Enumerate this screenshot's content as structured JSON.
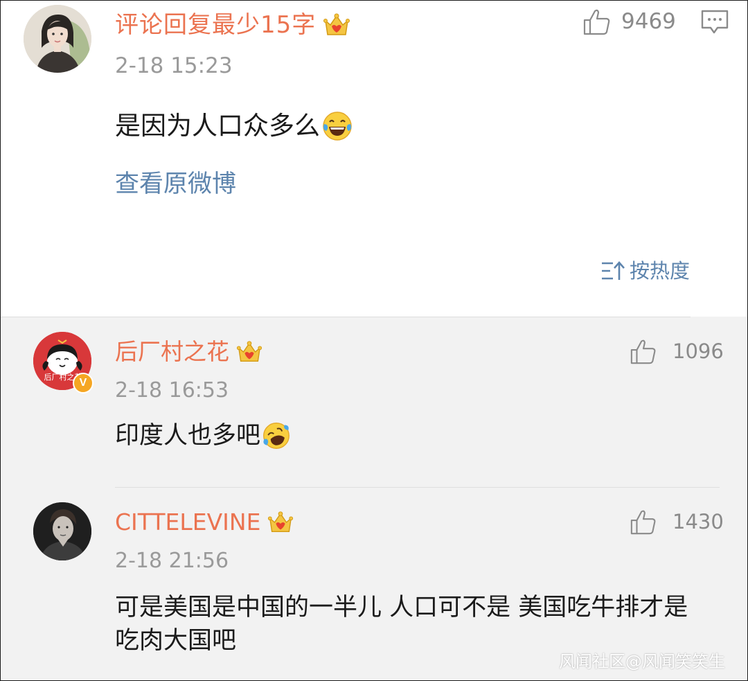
{
  "main_comment": {
    "user_name": "评论回复最少15字",
    "time": "2-18 15:23",
    "likes": "9469",
    "text": "是因为人口众多么",
    "view_original_label": "查看原微博",
    "sort_label": "按热度",
    "emoji": "laugh-tears-emoji"
  },
  "replies": [
    {
      "user_name": "后厂村之花",
      "avatar_text": "后厂村之花",
      "verified": "V",
      "time": "2-18 16:53",
      "likes": "1096",
      "text": "印度人也多吧",
      "emoji": "rolling-laugh-emoji"
    },
    {
      "user_name": "CITTELEVINE",
      "time": "2-18 21:56",
      "likes": "1430",
      "text": "可是美国是中国的一半儿 人口可不是 美国吃牛排才是吃肉大国吧"
    }
  ],
  "watermark": "风闻社区@风闻笑笑生",
  "colors": {
    "username": "#eb7350",
    "link": "#5d84ad",
    "meta": "#9a9a9a",
    "reply_bg": "#f2f2f2"
  }
}
